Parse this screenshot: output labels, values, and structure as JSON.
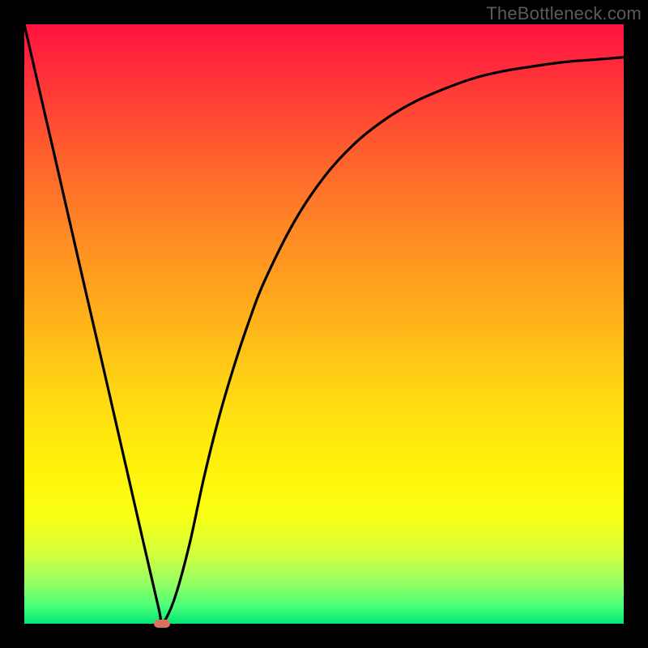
{
  "watermark": "TheBottleneck.com",
  "chart_data": {
    "type": "line",
    "title": "",
    "xlabel": "",
    "ylabel": "",
    "xlim": [
      0,
      1
    ],
    "ylim": [
      0,
      1
    ],
    "grid": false,
    "legend": false,
    "background": "rainbow-gradient-red-to-green-vertical",
    "frame_color": "#000000",
    "series": [
      {
        "name": "bottleneck-curve",
        "color": "#000000",
        "x": [
          0.0,
          0.025,
          0.05,
          0.075,
          0.1,
          0.125,
          0.15,
          0.175,
          0.2,
          0.225,
          0.23,
          0.25,
          0.275,
          0.3,
          0.325,
          0.35,
          0.375,
          0.4,
          0.45,
          0.5,
          0.55,
          0.6,
          0.65,
          0.7,
          0.75,
          0.8,
          0.85,
          0.9,
          0.95,
          1.0
        ],
        "y": [
          1.0,
          0.891,
          0.783,
          0.674,
          0.565,
          0.457,
          0.348,
          0.239,
          0.13,
          0.022,
          0.0,
          0.04,
          0.13,
          0.245,
          0.345,
          0.43,
          0.505,
          0.57,
          0.67,
          0.745,
          0.8,
          0.84,
          0.87,
          0.892,
          0.91,
          0.922,
          0.93,
          0.937,
          0.941,
          0.945
        ]
      }
    ],
    "marker": {
      "x": 0.23,
      "y": 0.0,
      "shape": "pill",
      "color": "#d8725c"
    }
  }
}
